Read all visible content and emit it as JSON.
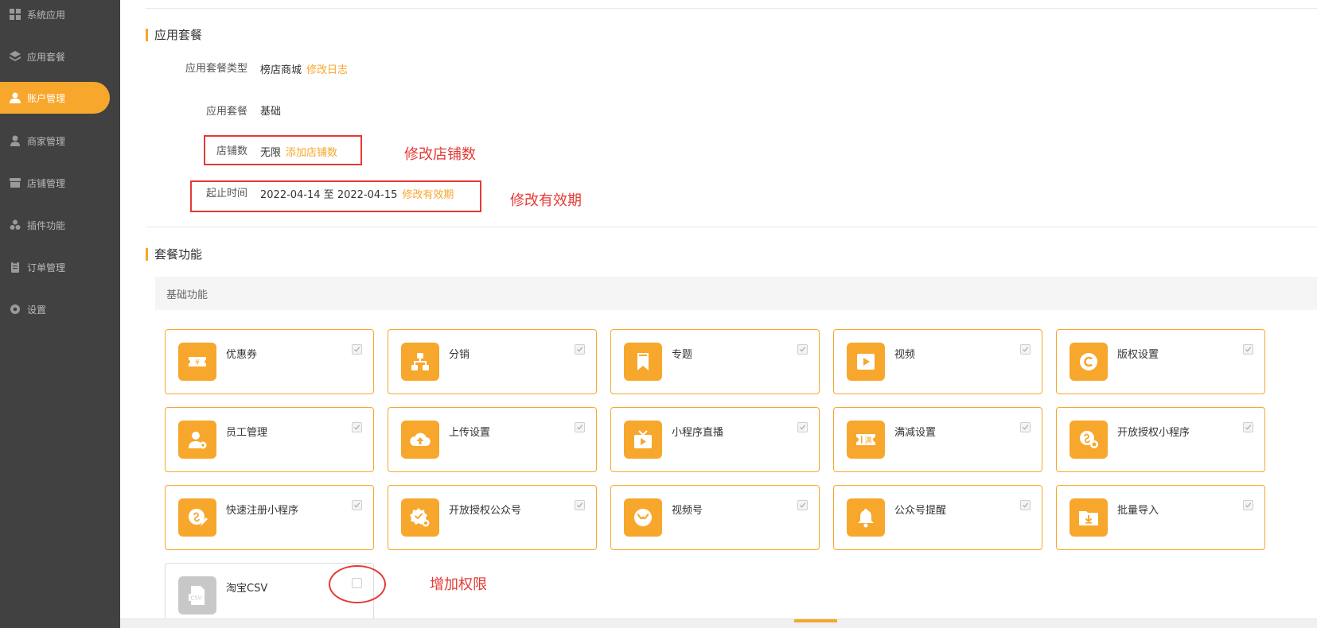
{
  "sidebar": {
    "items": [
      {
        "label": "系统应用",
        "icon": "grid-icon",
        "active": false
      },
      {
        "label": "应用套餐",
        "icon": "layers-icon",
        "active": false
      },
      {
        "label": "账户管理",
        "icon": "user-icon",
        "active": true
      },
      {
        "label": "商家管理",
        "icon": "users-icon",
        "active": false
      },
      {
        "label": "店铺管理",
        "icon": "store-icon",
        "active": false
      },
      {
        "label": "插件功能",
        "icon": "plugin-icon",
        "active": false
      },
      {
        "label": "订单管理",
        "icon": "clipboard-icon",
        "active": false
      },
      {
        "label": "设置",
        "icon": "gear-icon",
        "active": false
      }
    ]
  },
  "package": {
    "title": "应用套餐",
    "type_label": "应用套餐类型",
    "type_value": "榜店商城",
    "type_link": "修改日志",
    "plan_label": "应用套餐",
    "plan_value": "基础",
    "stores_label": "店铺数",
    "stores_value": "无限",
    "stores_link": "添加店铺数",
    "period_label": "起止时间",
    "period_value": "2022-04-14 至 2022-04-15",
    "period_link": "修改有效期"
  },
  "annotations": {
    "stores_note": "修改店铺数",
    "period_note": "修改有效期",
    "permission_note": "增加权限",
    "color": "#e53935"
  },
  "features": {
    "title": "套餐功能",
    "group": "基础功能",
    "items": [
      {
        "name": "优惠券",
        "icon": "coupon-icon",
        "checked": true
      },
      {
        "name": "分销",
        "icon": "hierarchy-icon",
        "checked": true
      },
      {
        "name": "专题",
        "icon": "bookmark-icon",
        "checked": true
      },
      {
        "name": "视频",
        "icon": "play-icon",
        "checked": true
      },
      {
        "name": "版权设置",
        "icon": "copyright-icon",
        "checked": true
      },
      {
        "name": "员工管理",
        "icon": "staff-gear-icon",
        "checked": true
      },
      {
        "name": "上传设置",
        "icon": "cloud-upload-icon",
        "checked": true
      },
      {
        "name": "小程序直播",
        "icon": "tv-live-icon",
        "checked": true
      },
      {
        "name": "满减设置",
        "icon": "ticket-discount-icon",
        "checked": true
      },
      {
        "name": "开放授权小程序",
        "icon": "miniprogram-badge-icon",
        "checked": true
      },
      {
        "name": "快速注册小程序",
        "icon": "miniprogram-edit-icon",
        "checked": true
      },
      {
        "name": "开放授权公众号",
        "icon": "verified-badge-icon",
        "checked": true
      },
      {
        "name": "视频号",
        "icon": "channels-icon",
        "checked": true
      },
      {
        "name": "公众号提醒",
        "icon": "bell-icon",
        "checked": true
      },
      {
        "name": "批量导入",
        "icon": "folder-download-icon",
        "checked": true
      },
      {
        "name": "淘宝CSV",
        "icon": "csv-file-icon",
        "checked": false,
        "disabled_style": true
      }
    ]
  },
  "colors": {
    "accent": "#f7a72c",
    "sidebar_bg": "#414141"
  }
}
